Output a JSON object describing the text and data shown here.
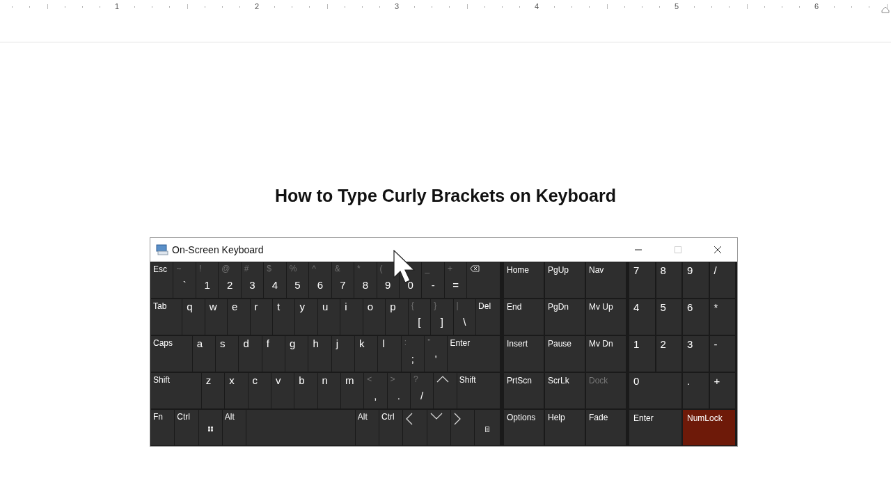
{
  "ruler": {
    "numbers": [
      "1",
      "2",
      "3",
      "4",
      "5",
      "6"
    ]
  },
  "heading": "How to Type Curly Brackets on Keyboard",
  "window": {
    "title": "On-Screen Keyboard",
    "controls": [
      {
        "kind": "minimize",
        "disabled": false
      },
      {
        "kind": "maximize",
        "disabled": true
      },
      {
        "kind": "close",
        "disabled": false
      }
    ]
  },
  "main_rows": [
    [
      {
        "kind": "mod",
        "label": "Esc"
      },
      {
        "kind": "dual",
        "shift": "~",
        "label": "`"
      },
      {
        "kind": "dual",
        "shift": "!",
        "label": "1"
      },
      {
        "kind": "dual",
        "shift": "@",
        "label": "2"
      },
      {
        "kind": "dual",
        "shift": "#",
        "label": "3"
      },
      {
        "kind": "dual",
        "shift": "$",
        "label": "4"
      },
      {
        "kind": "dual",
        "shift": "%",
        "label": "5"
      },
      {
        "kind": "dual",
        "shift": "^",
        "label": "6"
      },
      {
        "kind": "dual",
        "shift": "&",
        "label": "7"
      },
      {
        "kind": "dual",
        "shift": "*",
        "label": "8"
      },
      {
        "kind": "dual",
        "shift": "(",
        "label": "9"
      },
      {
        "kind": "dual",
        "label": "0"
      },
      {
        "kind": "dual",
        "shift": "_",
        "label": "-"
      },
      {
        "kind": "dual",
        "shift": "+",
        "label": "="
      },
      {
        "kind": "backspace"
      }
    ],
    [
      {
        "kind": "mod",
        "label": "Tab"
      },
      {
        "kind": "letter",
        "label": "q"
      },
      {
        "kind": "letter",
        "label": "w"
      },
      {
        "kind": "letter",
        "label": "e"
      },
      {
        "kind": "letter",
        "label": "r"
      },
      {
        "kind": "letter",
        "label": "t"
      },
      {
        "kind": "letter",
        "label": "y"
      },
      {
        "kind": "letter",
        "label": "u"
      },
      {
        "kind": "letter",
        "label": "i"
      },
      {
        "kind": "letter",
        "label": "o"
      },
      {
        "kind": "letter",
        "label": "p"
      },
      {
        "kind": "dual",
        "shift": "{",
        "label": "["
      },
      {
        "kind": "dual",
        "shift": "}",
        "label": "]"
      },
      {
        "kind": "dual",
        "shift": "|",
        "label": "\\"
      },
      {
        "kind": "mod",
        "label": "Del"
      }
    ],
    [
      {
        "kind": "mod",
        "label": "Caps"
      },
      {
        "kind": "letter",
        "label": "a"
      },
      {
        "kind": "letter",
        "label": "s"
      },
      {
        "kind": "letter",
        "label": "d"
      },
      {
        "kind": "letter",
        "label": "f"
      },
      {
        "kind": "letter",
        "label": "g"
      },
      {
        "kind": "letter",
        "label": "h"
      },
      {
        "kind": "letter",
        "label": "j"
      },
      {
        "kind": "letter",
        "label": "k"
      },
      {
        "kind": "letter",
        "label": "l"
      },
      {
        "kind": "dual",
        "shift": ":",
        "label": ";"
      },
      {
        "kind": "dual",
        "shift": "\"",
        "label": "'"
      },
      {
        "kind": "mod",
        "label": "Enter"
      }
    ],
    [
      {
        "kind": "mod",
        "label": "Shift"
      },
      {
        "kind": "letter",
        "label": "z"
      },
      {
        "kind": "letter",
        "label": "x"
      },
      {
        "kind": "letter",
        "label": "c"
      },
      {
        "kind": "letter",
        "label": "v"
      },
      {
        "kind": "letter",
        "label": "b"
      },
      {
        "kind": "letter",
        "label": "n"
      },
      {
        "kind": "letter",
        "label": "m"
      },
      {
        "kind": "dual",
        "shift": "<",
        "label": ","
      },
      {
        "kind": "dual",
        "shift": ">",
        "label": "."
      },
      {
        "kind": "dual",
        "shift": "?",
        "label": "/"
      },
      {
        "kind": "up"
      },
      {
        "kind": "mod",
        "label": "Shift"
      }
    ],
    [
      {
        "kind": "mod",
        "label": "Fn"
      },
      {
        "kind": "mod",
        "label": "Ctrl"
      },
      {
        "kind": "windows"
      },
      {
        "kind": "mod",
        "label": "Alt"
      },
      {
        "kind": "space"
      },
      {
        "kind": "mod",
        "label": "Alt"
      },
      {
        "kind": "mod",
        "label": "Ctrl"
      },
      {
        "kind": "left"
      },
      {
        "kind": "down"
      },
      {
        "kind": "right"
      },
      {
        "kind": "menu"
      }
    ]
  ],
  "nav_rows": [
    [
      {
        "label": "Home",
        "disabled": false
      },
      {
        "label": "PgUp",
        "disabled": false
      },
      {
        "label": "Nav",
        "disabled": false
      }
    ],
    [
      {
        "label": "End",
        "disabled": false
      },
      {
        "label": "PgDn",
        "disabled": false
      },
      {
        "label": "Mv Up",
        "disabled": false
      }
    ],
    [
      {
        "label": "Insert",
        "disabled": false
      },
      {
        "label": "Pause",
        "disabled": false
      },
      {
        "label": "Mv Dn",
        "disabled": false
      }
    ],
    [
      {
        "label": "PrtScn",
        "disabled": false
      },
      {
        "label": "ScrLk",
        "disabled": false
      },
      {
        "label": "Dock",
        "disabled": true
      }
    ],
    [
      {
        "label": "Options",
        "disabled": false
      },
      {
        "label": "Help",
        "disabled": false
      },
      {
        "label": "Fade",
        "disabled": false
      }
    ]
  ],
  "numpad_rows": [
    [
      {
        "label": "7",
        "on": false
      },
      {
        "label": "8",
        "on": false
      },
      {
        "label": "9",
        "on": false
      },
      {
        "label": "/",
        "on": false
      }
    ],
    [
      {
        "label": "4",
        "on": false
      },
      {
        "label": "5",
        "on": false
      },
      {
        "label": "6",
        "on": false
      },
      {
        "label": "*",
        "on": false
      }
    ],
    [
      {
        "label": "1",
        "on": false
      },
      {
        "label": "2",
        "on": false
      },
      {
        "label": "3",
        "on": false
      },
      {
        "label": "-",
        "on": false
      }
    ],
    [
      {
        "label": "0",
        "on": false
      },
      {
        "label": ".",
        "on": false
      },
      {
        "label": "+",
        "on": false
      }
    ],
    [
      {
        "label": "Enter",
        "on": false
      },
      {
        "label": "NumLock",
        "on": true
      }
    ]
  ]
}
